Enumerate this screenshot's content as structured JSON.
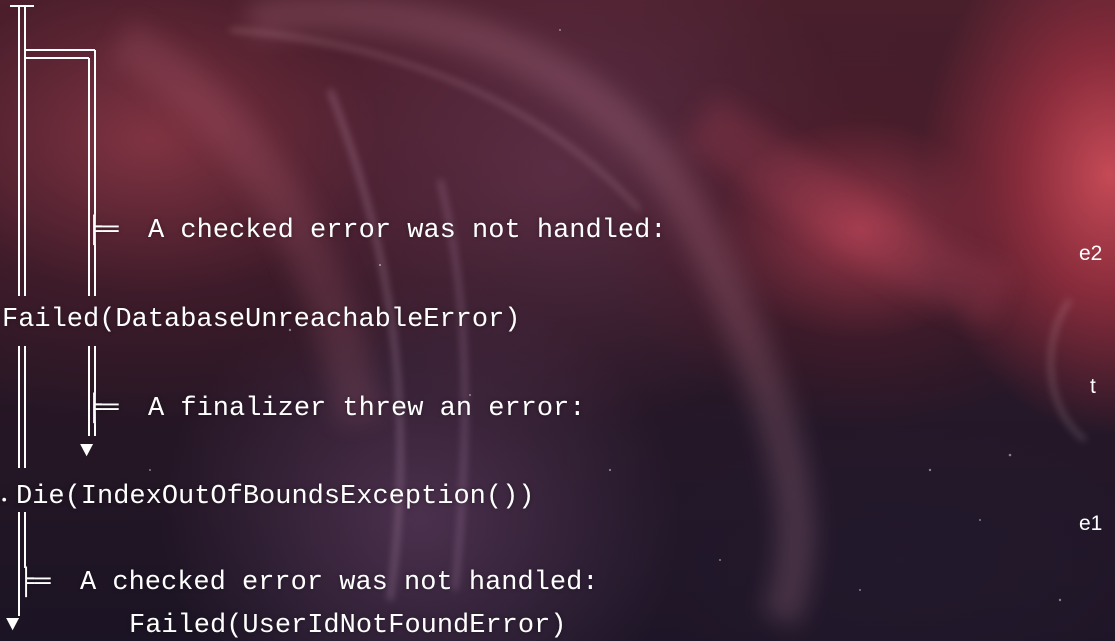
{
  "trace": {
    "line1": "A checked error was not handled:",
    "line2": "Failed(DatabaseUnreachableError)",
    "line3": "A finalizer threw an error:",
    "line4": "Die(IndexOutOfBoundsException())",
    "line5": "A checked error was not handled:",
    "line6": "Failed(UserIdNotFoundError)"
  },
  "side_labels": {
    "top": "e2",
    "middle": "t",
    "bottom": "e1"
  },
  "glyphs": {
    "arrow": "▼",
    "branch": "╞═",
    "dot": "•"
  },
  "colors": {
    "text": "#ffffff",
    "background_dark": "#1b1424",
    "background_warm": "#c54a56"
  }
}
